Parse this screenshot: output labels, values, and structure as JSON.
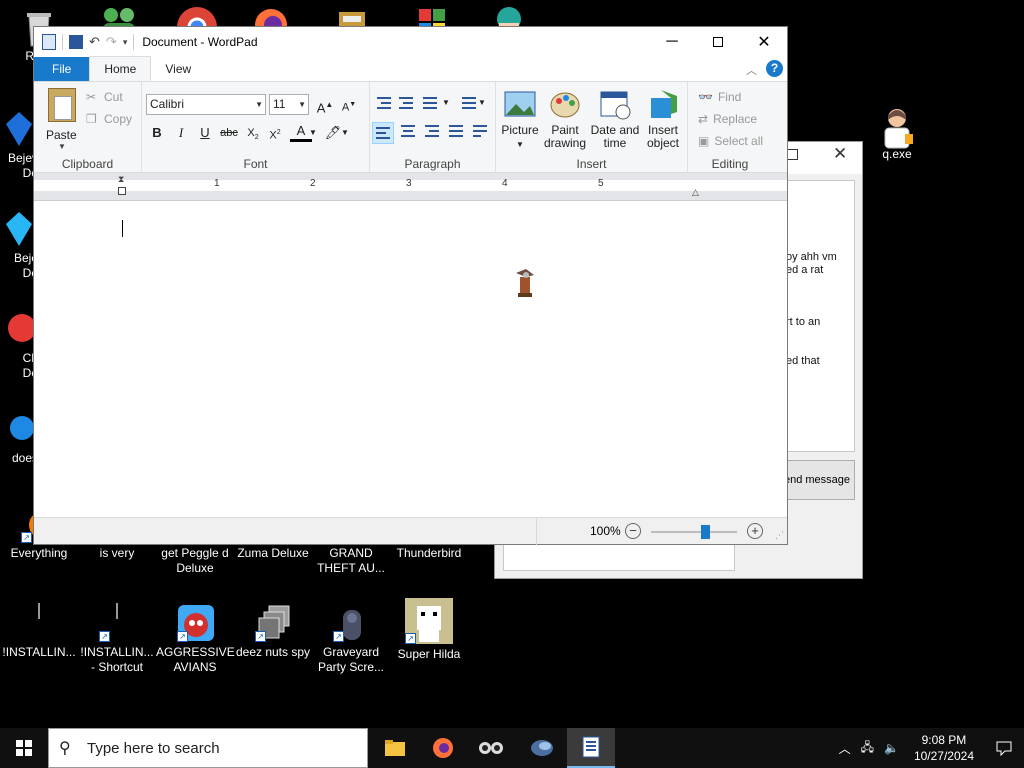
{
  "desktop": {
    "icons_row1": [
      {
        "label": "Recy",
        "icon": "recycle-bin-icon"
      },
      {
        "label": "",
        "icon": "people-icon"
      },
      {
        "label": "",
        "icon": "chrome-icon"
      },
      {
        "label": "",
        "icon": "firefox-icon"
      },
      {
        "label": "",
        "icon": "winrar-icon"
      },
      {
        "label": "",
        "icon": "windows-shield-icon"
      },
      {
        "label": "",
        "icon": "anime-character-icon"
      }
    ],
    "left_partial": [
      "Bejev",
      "De",
      "Beje",
      "De",
      "Ch",
      "De",
      "does"
    ],
    "right_icon": {
      "label": "q.exe",
      "icon": "person-icon"
    },
    "icons_row_bottom1": [
      {
        "label": "Everything"
      },
      {
        "label": "is very"
      },
      {
        "label": "get Peggle d Deluxe"
      },
      {
        "label": "Zuma Deluxe"
      },
      {
        "label": "GRAND THEFT AU..."
      },
      {
        "label": "Thunderbird"
      }
    ],
    "icons_row_bottom2": [
      {
        "label": "!INSTALLIN..."
      },
      {
        "label": "!INSTALLIN... - Shortcut"
      },
      {
        "label": "AGGRESSIVE AVIANS"
      },
      {
        "label": "deez nuts spy"
      },
      {
        "label": "Graveyard Party Scre..."
      },
      {
        "label": "Super Hilda"
      }
    ]
  },
  "chat_window": {
    "lines": [
      "oy ahh vm",
      "ed a rat",
      "rt to an",
      "ed that"
    ],
    "send_label": "end message"
  },
  "wordpad": {
    "title": "Document - WordPad",
    "tabs": [
      "File",
      "Home",
      "View"
    ],
    "clipboard": {
      "paste": "Paste",
      "cut": "Cut",
      "copy": "Copy",
      "label": "Clipboard"
    },
    "font": {
      "family": "Calibri",
      "size": "11",
      "label": "Font"
    },
    "paragraph": {
      "label": "Paragraph"
    },
    "insert": {
      "picture": "Picture",
      "paint": "Paint drawing",
      "datetime": "Date and time",
      "object": "Insert object",
      "label": "Insert"
    },
    "editing": {
      "find": "Find",
      "replace": "Replace",
      "select_all": "Select all",
      "label": "Editing"
    },
    "ruler_numbers": [
      "1",
      "2",
      "3",
      "4",
      "5"
    ],
    "zoom": {
      "label": "100%",
      "level_percent": 100
    }
  },
  "taskbar": {
    "search_placeholder": "Type here to search",
    "time": "9:08 PM",
    "date": "10/27/2024"
  }
}
